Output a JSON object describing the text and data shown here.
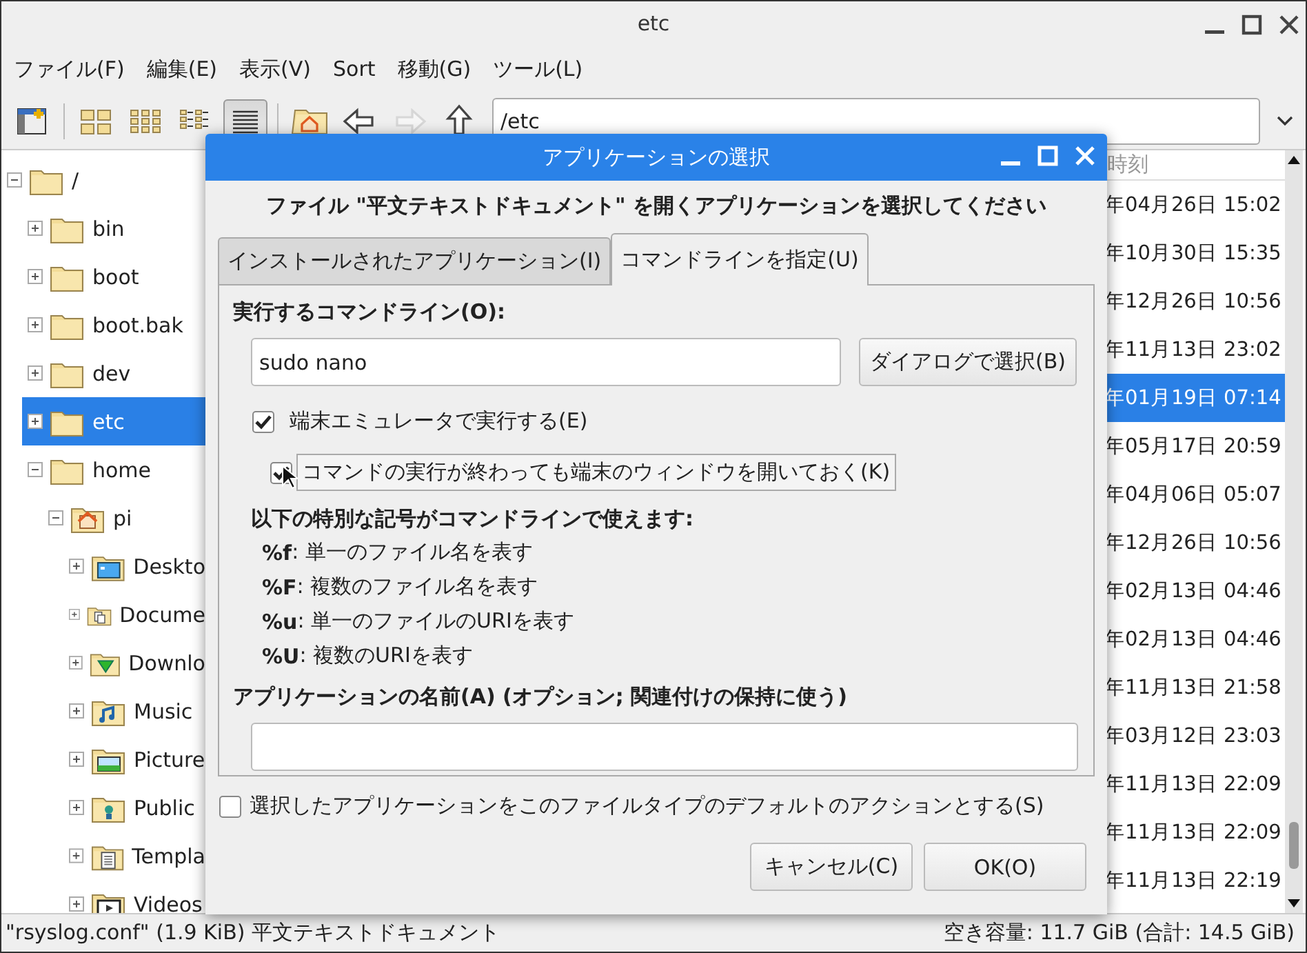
{
  "window": {
    "title": "etc"
  },
  "menu": [
    "ファイル(F)",
    "編集(E)",
    "表示(V)",
    "Sort",
    "移動(G)",
    "ツール(L)"
  ],
  "toolbar": {
    "buttons": [
      {
        "kind": "new-window",
        "pressed": false,
        "disabled": false
      },
      {
        "kind": "separator"
      },
      {
        "kind": "icon-view",
        "pressed": false,
        "disabled": false
      },
      {
        "kind": "thumbnail-view",
        "pressed": false,
        "disabled": false
      },
      {
        "kind": "compact-view",
        "pressed": false,
        "disabled": false
      },
      {
        "kind": "list-view",
        "pressed": true,
        "disabled": false
      },
      {
        "kind": "separator"
      },
      {
        "kind": "home",
        "pressed": false,
        "disabled": false
      },
      {
        "kind": "back",
        "pressed": false,
        "disabled": false
      },
      {
        "kind": "forward",
        "pressed": false,
        "disabled": true
      },
      {
        "kind": "up",
        "pressed": false,
        "disabled": false
      }
    ],
    "path": "/etc"
  },
  "tree": [
    {
      "label": "/",
      "kind": "folder",
      "expanded": true,
      "selected": false,
      "children": [
        {
          "label": "bin",
          "kind": "folder",
          "expanded": false,
          "selected": false
        },
        {
          "label": "boot",
          "kind": "folder",
          "expanded": false,
          "selected": false
        },
        {
          "label": "boot.bak",
          "kind": "folder",
          "expanded": false,
          "selected": false
        },
        {
          "label": "dev",
          "kind": "folder",
          "expanded": false,
          "selected": false
        },
        {
          "label": "etc",
          "kind": "folder",
          "expanded": false,
          "selected": true
        },
        {
          "label": "home",
          "kind": "folder",
          "expanded": true,
          "selected": false,
          "children": [
            {
              "label": "pi",
              "kind": "home",
              "expanded": true,
              "selected": false,
              "children": [
                {
                  "label": "Deskto",
                  "kind": "desktop",
                  "expanded": false,
                  "selected": false
                },
                {
                  "label": "Docume",
                  "kind": "documents",
                  "expanded": false,
                  "selected": false
                },
                {
                  "label": "Downlo",
                  "kind": "download",
                  "expanded": false,
                  "selected": false
                },
                {
                  "label": "Music",
                  "kind": "music",
                  "expanded": false,
                  "selected": false
                },
                {
                  "label": "Picture",
                  "kind": "pictures",
                  "expanded": false,
                  "selected": false
                },
                {
                  "label": "Public",
                  "kind": "public",
                  "expanded": false,
                  "selected": false
                },
                {
                  "label": "Templa",
                  "kind": "templates",
                  "expanded": false,
                  "selected": false
                },
                {
                  "label": "Videos",
                  "kind": "videos",
                  "expanded": false,
                  "selected": false
                }
              ]
            }
          ]
        }
      ]
    }
  ],
  "file_list": {
    "column_header": "時刻",
    "rows": [
      {
        "modified": "年04月26日 15:02",
        "selected": false
      },
      {
        "modified": "年10月30日 15:35",
        "selected": false
      },
      {
        "modified": "年12月26日 10:56",
        "selected": false
      },
      {
        "modified": "年11月13日 23:02",
        "selected": false
      },
      {
        "modified": "年01月19日 07:14",
        "selected": true
      },
      {
        "modified": "年05月17日 20:59",
        "selected": false
      },
      {
        "modified": "年04月06日 05:07",
        "selected": false
      },
      {
        "modified": "年12月26日 10:56",
        "selected": false
      },
      {
        "modified": "年02月13日 04:46",
        "selected": false
      },
      {
        "modified": "年02月13日 04:46",
        "selected": false
      },
      {
        "modified": "年11月13日 21:58",
        "selected": false
      },
      {
        "modified": "年03月12日 23:03",
        "selected": false
      },
      {
        "modified": "年11月13日 22:09",
        "selected": false
      },
      {
        "modified": "年11月13日 22:09",
        "selected": false
      },
      {
        "modified": "年11月13日 22:19",
        "selected": false
      }
    ]
  },
  "status_bar": {
    "left": "\"rsyslog.conf\" (1.9 KiB) 平文テキストドキュメント",
    "right": "空き容量: 11.7 GiB (合計: 14.5 GiB)"
  },
  "dialog": {
    "title": "アプリケーションの選択",
    "heading": "ファイル \"平文テキストドキュメント\" を開くアプリケーションを選択してください",
    "tabs": [
      {
        "label": "インストールされたアプリケーション(I)",
        "selected": false
      },
      {
        "label": "コマンドラインを指定(U)",
        "selected": true
      }
    ],
    "command_label": "実行するコマンドライン(O):",
    "command_value": "sudo nano",
    "browse_button": "ダイアログで選択(B)",
    "options": [
      {
        "label": "端末エミュレータで実行する(E)",
        "checked": true,
        "focused": false,
        "indented": false
      },
      {
        "label": "コマンドの実行が終わっても端末のウィンドウを開いておく(K)",
        "checked": true,
        "focused": true,
        "indented": true
      }
    ],
    "codes_heading": "以下の特別な記号がコマンドラインで使えます:",
    "codes": [
      "**%f**: 単一のファイル名を表す",
      "**%F**: 複数のファイル名を表す",
      "**%u**: 単一のファイルのURIを表す",
      "**%U**: 複数のURIを表す"
    ],
    "name_label": "アプリケーションの名前(A) (オプション; 関連付けの保持に使う)",
    "default_option": {
      "label": "選択したアプリケーションをこのファイルタイプのデフォルトのアクションとする(S)",
      "checked": false
    },
    "buttons": [
      "キャンセル(C)",
      "OK(O)"
    ]
  }
}
